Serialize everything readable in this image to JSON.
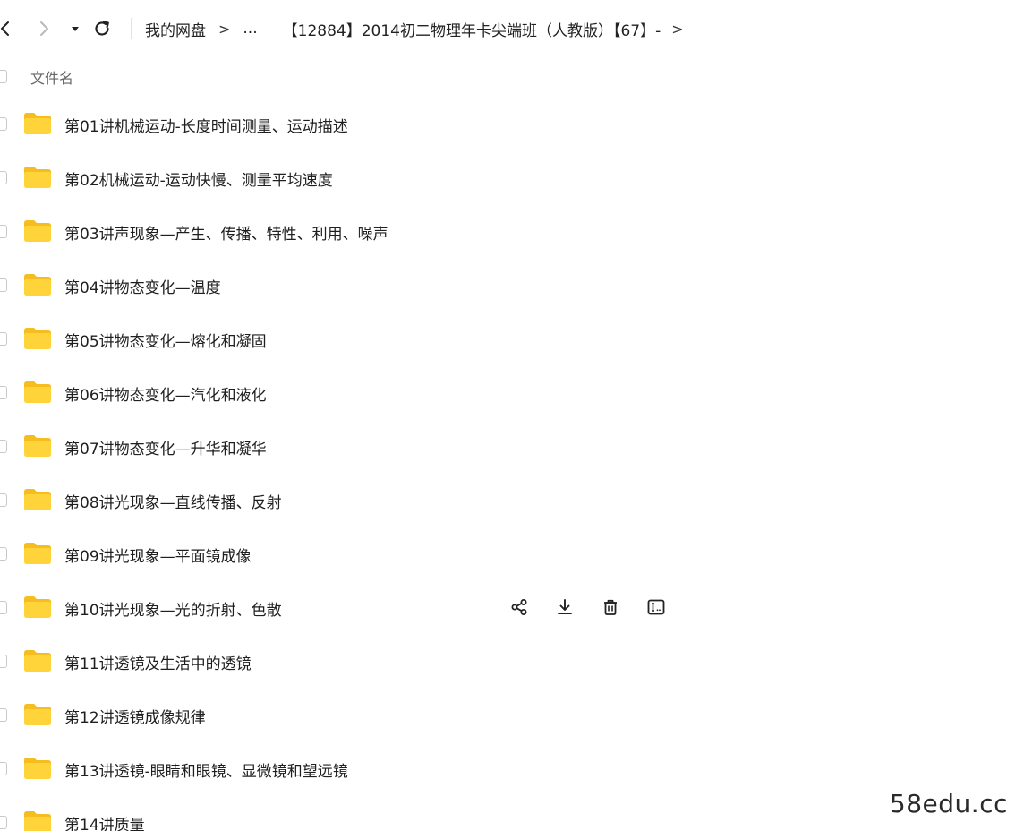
{
  "toolbar": {
    "back_icon": "chevron-left-icon",
    "forward_icon": "chevron-right-icon",
    "history_icon": "caret-down-icon",
    "refresh_icon": "refresh-icon"
  },
  "breadcrumb": {
    "root": "我的网盘",
    "separator": ">",
    "ellipsis": "...",
    "current": "【12884】2014初二物理年卡尖端班（人教版）【67】-",
    "trailing_separator": ">"
  },
  "list_header": {
    "name_column": "文件名"
  },
  "files": [
    {
      "name": "第01讲机械运动-长度时间测量、运动描述",
      "type": "folder"
    },
    {
      "name": "第02机械运动-运动快慢、测量平均速度",
      "type": "folder"
    },
    {
      "name": "第03讲声现象—产生、传播、特性、利用、噪声",
      "type": "folder"
    },
    {
      "name": "第04讲物态变化—温度",
      "type": "folder"
    },
    {
      "name": "第05讲物态变化—熔化和凝固",
      "type": "folder"
    },
    {
      "name": "第06讲物态变化—汽化和液化",
      "type": "folder"
    },
    {
      "name": "第07讲物态变化—升华和凝华",
      "type": "folder"
    },
    {
      "name": "第08讲光现象—直线传播、反射",
      "type": "folder"
    },
    {
      "name": "第09讲光现象—平面镜成像",
      "type": "folder"
    },
    {
      "name": "第10讲光现象—光的折射、色散",
      "type": "folder",
      "hovered": true
    },
    {
      "name": "第11讲透镜及生活中的透镜",
      "type": "folder"
    },
    {
      "name": "第12讲透镜成像规律",
      "type": "folder"
    },
    {
      "name": "第13讲透镜-眼睛和眼镜、显微镜和望远镜",
      "type": "folder"
    },
    {
      "name": "第14讲质量",
      "type": "folder"
    }
  ],
  "row_actions": [
    "share-icon",
    "download-icon",
    "delete-icon",
    "rename-icon"
  ],
  "watermark": "58edu.cc",
  "colors": {
    "folder": "#FFD43B",
    "folder_tab": "#F5BE1E",
    "text": "#1f1f1f",
    "muted": "#666666"
  }
}
